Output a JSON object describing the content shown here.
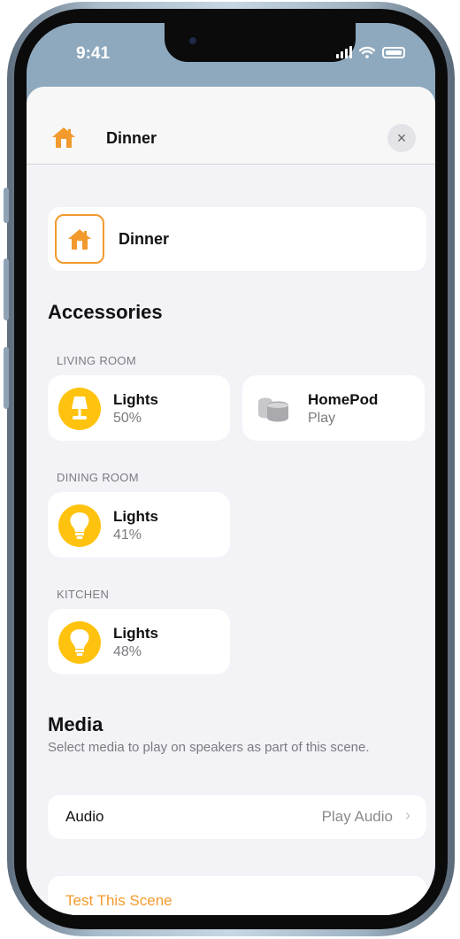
{
  "status_bar": {
    "time": "9:41"
  },
  "header": {
    "title": "Dinner",
    "close_symbol": "×"
  },
  "scene": {
    "name": "Dinner"
  },
  "accessories": {
    "title": "Accessories",
    "rooms": [
      {
        "label": "LIVING ROOM",
        "tiles": [
          {
            "name": "Lights",
            "value": "50%",
            "icon": "lamp-icon"
          },
          {
            "name": "HomePod",
            "value": "Play",
            "icon": "homepod-icon"
          }
        ]
      },
      {
        "label": "DINING ROOM",
        "tiles": [
          {
            "name": "Lights",
            "value": "41%",
            "icon": "lightbulb-icon"
          }
        ]
      },
      {
        "label": "KITCHEN",
        "tiles": [
          {
            "name": "Lights",
            "value": "48%",
            "icon": "lightbulb-icon"
          }
        ]
      }
    ]
  },
  "media": {
    "title": "Media",
    "subtitle": "Select media to play on speakers as part of this scene.",
    "audio_label": "Audio",
    "audio_value": "Play Audio"
  },
  "actions": {
    "test_scene": "Test This Scene"
  },
  "colors": {
    "accent": "#f29a2e",
    "light_on": "#ffc20e",
    "background": "#f2f2f7"
  }
}
